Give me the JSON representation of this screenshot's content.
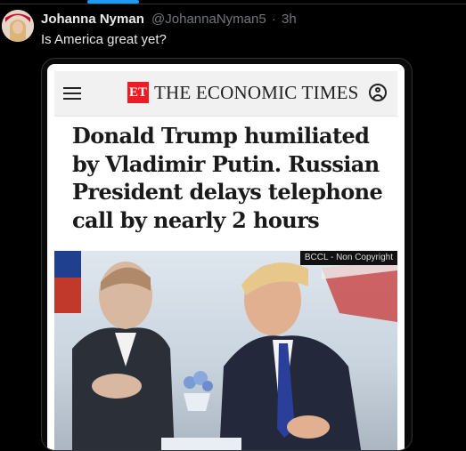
{
  "tweet": {
    "author_name": "Johanna Nyman",
    "handle": "@JohannaNyman5",
    "separator": "·",
    "time": "3h",
    "text": "Is America great yet?"
  },
  "article": {
    "logo_mark": "ET",
    "logo_text": "THE ECONOMIC TIMES",
    "headline_lines": [
      "Donald Trump humiliated",
      "by Vladimir Putin.  Russian",
      "President delays telephone",
      "call by nearly 2 hours"
    ],
    "photo_credit": "BCCL - Non Copyright"
  },
  "colors": {
    "background": "#000000",
    "accent": "#1d9bf0",
    "et_red": "#ed1c24"
  }
}
